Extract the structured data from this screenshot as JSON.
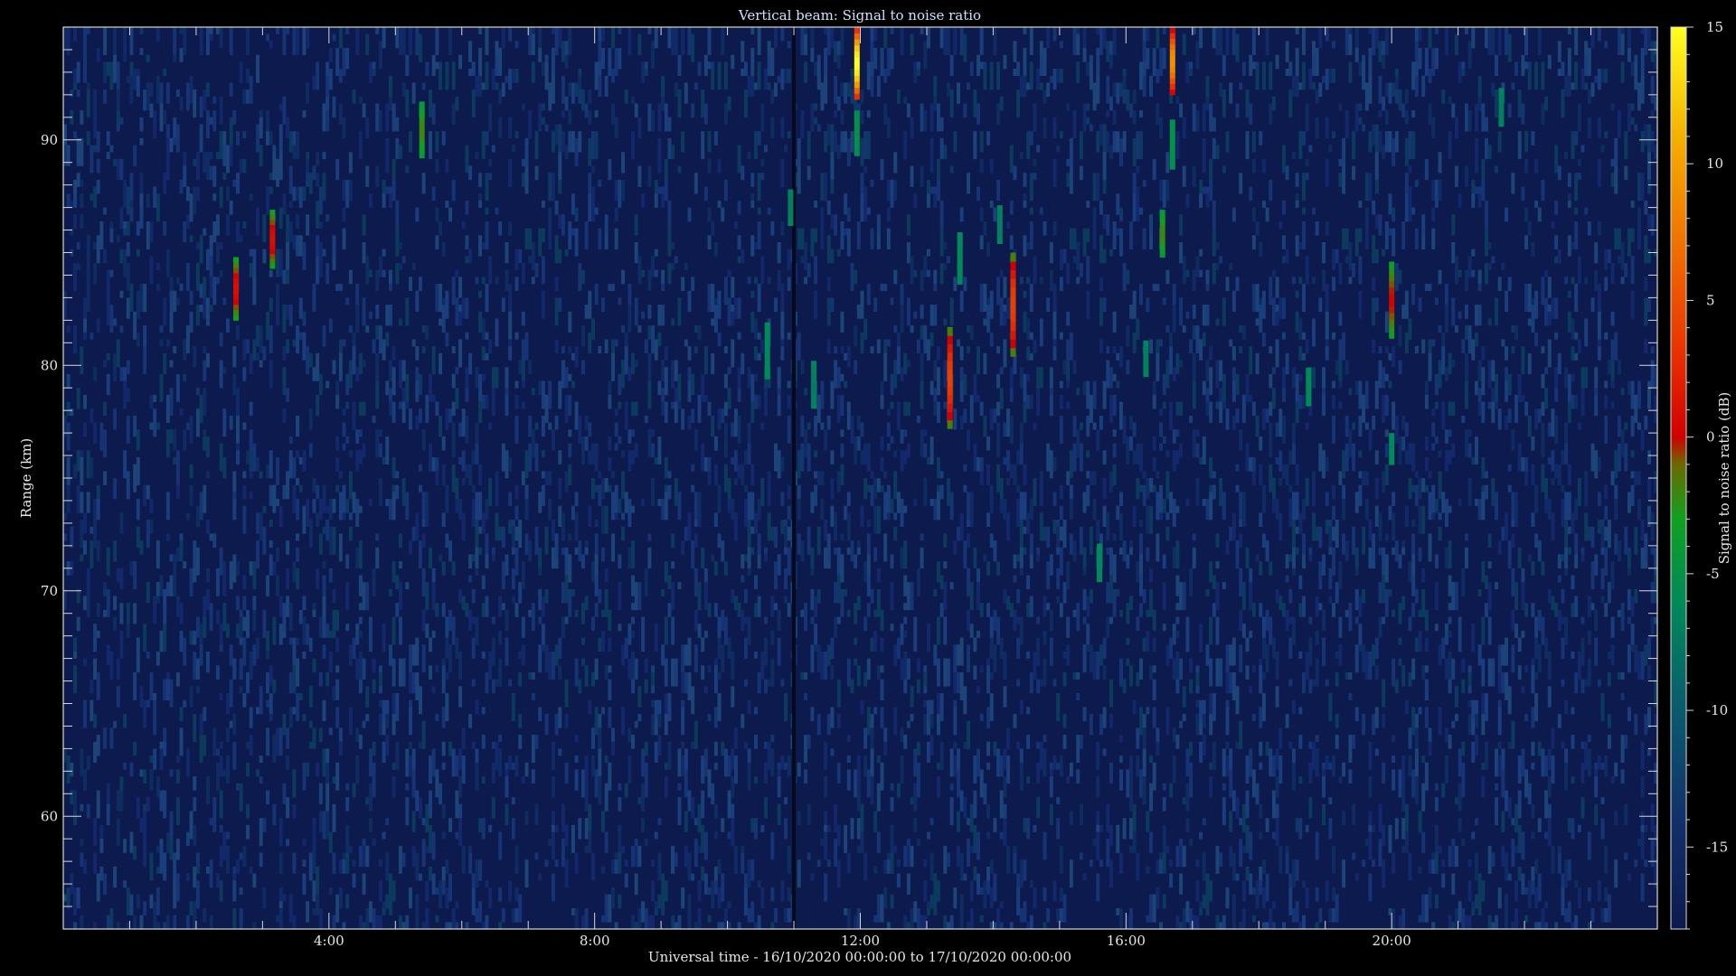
{
  "chart_data": {
    "type": "heatmap",
    "title": "Vertical beam: Signal to noise ratio",
    "xlabel": "Universal time - 16/10/2020 00:00:00 to 17/10/2020 00:00:00",
    "ylabel": "Range (km)",
    "xlim": [
      0,
      24
    ],
    "ylim": [
      55,
      95
    ],
    "x_ticks": [
      {
        "value": 4,
        "label": "4:00"
      },
      {
        "value": 8,
        "label": "8:00"
      },
      {
        "value": 12,
        "label": "12:00"
      },
      {
        "value": 16,
        "label": "16:00"
      },
      {
        "value": 20,
        "label": "20:00"
      }
    ],
    "y_ticks": [
      {
        "value": 60,
        "label": "60"
      },
      {
        "value": 70,
        "label": "70"
      },
      {
        "value": 80,
        "label": "80"
      },
      {
        "value": 90,
        "label": "90"
      }
    ],
    "colorbar": {
      "label": "Signal to noise ratio (dB)",
      "range": [
        -18,
        15
      ],
      "ticks": [
        {
          "value": 15,
          "label": "15"
        },
        {
          "value": 10,
          "label": "10"
        },
        {
          "value": 5,
          "label": "5"
        },
        {
          "value": 0,
          "label": "0"
        },
        {
          "value": -5,
          "label": "-5"
        },
        {
          "value": -10,
          "label": "-10"
        },
        {
          "value": -15,
          "label": "-15"
        }
      ],
      "stops": [
        {
          "value": -18,
          "color": "#0d1a4d"
        },
        {
          "value": -14,
          "color": "#12306a"
        },
        {
          "value": -10,
          "color": "#0a5a6e"
        },
        {
          "value": -6,
          "color": "#008a5a"
        },
        {
          "value": -3,
          "color": "#10a020"
        },
        {
          "value": -1,
          "color": "#6a6a00"
        },
        {
          "value": 0,
          "color": "#d00000"
        },
        {
          "value": 3,
          "color": "#e83000"
        },
        {
          "value": 7,
          "color": "#f07000"
        },
        {
          "value": 11,
          "color": "#f5b000"
        },
        {
          "value": 15,
          "color": "#ffff20"
        }
      ]
    },
    "background_noise_db": -16,
    "gap_time": 11.0,
    "echoes": [
      {
        "time": 2.6,
        "range_min": 82,
        "range_max": 84.8,
        "peak_db": 1
      },
      {
        "time": 3.15,
        "range_min": 84.3,
        "range_max": 86.9,
        "peak_db": 1
      },
      {
        "time": 5.4,
        "range_min": 89.2,
        "range_max": 91.7,
        "peak_db": -2
      },
      {
        "time": 10.6,
        "range_min": 79.4,
        "range_max": 81.9,
        "peak_db": -6
      },
      {
        "time": 10.95,
        "range_min": 86.2,
        "range_max": 87.8,
        "peak_db": -7
      },
      {
        "time": 11.3,
        "range_min": 78.1,
        "range_max": 80.2,
        "peak_db": -7
      },
      {
        "time": 11.95,
        "range_min": 91.8,
        "range_max": 95,
        "peak_db": 15
      },
      {
        "time": 11.95,
        "range_min": 89.3,
        "range_max": 91.3,
        "peak_db": -5
      },
      {
        "time": 13.35,
        "range_min": 77.2,
        "range_max": 81.7,
        "peak_db": 4
      },
      {
        "time": 13.5,
        "range_min": 83.6,
        "range_max": 85.9,
        "peak_db": -6
      },
      {
        "time": 14.1,
        "range_min": 85.4,
        "range_max": 87.1,
        "peak_db": -7
      },
      {
        "time": 14.3,
        "range_min": 80.4,
        "range_max": 85,
        "peak_db": 4
      },
      {
        "time": 15.6,
        "range_min": 70.4,
        "range_max": 72.1,
        "peak_db": -6
      },
      {
        "time": 16.3,
        "range_min": 79.5,
        "range_max": 81.1,
        "peak_db": -7
      },
      {
        "time": 16.55,
        "range_min": 84.8,
        "range_max": 86.9,
        "peak_db": -2
      },
      {
        "time": 16.7,
        "range_min": 92.0,
        "range_max": 95,
        "peak_db": 9
      },
      {
        "time": 16.7,
        "range_min": 88.7,
        "range_max": 90.9,
        "peak_db": -5
      },
      {
        "time": 18.75,
        "range_min": 78.2,
        "range_max": 79.9,
        "peak_db": -6
      },
      {
        "time": 20.0,
        "range_min": 81.2,
        "range_max": 84.6,
        "peak_db": 0
      },
      {
        "time": 20.0,
        "range_min": 75.6,
        "range_max": 77.0,
        "peak_db": -6
      },
      {
        "time": 21.65,
        "range_min": 90.6,
        "range_max": 92.3,
        "peak_db": -7
      }
    ]
  }
}
